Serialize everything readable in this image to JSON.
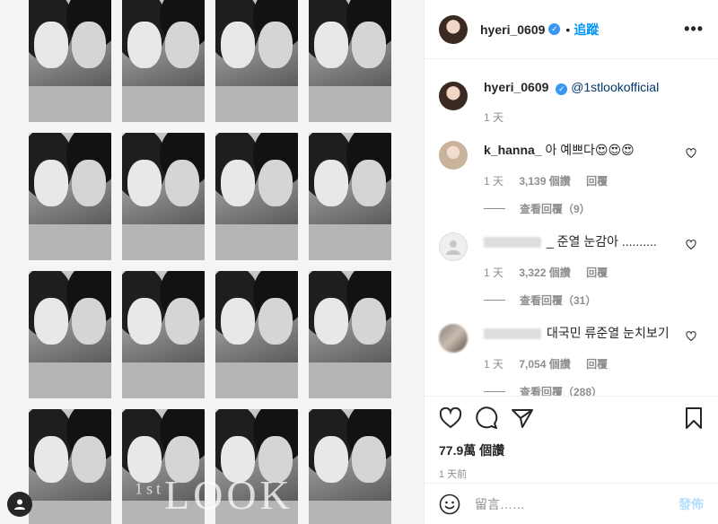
{
  "post_header": {
    "username": "hyeri_0609",
    "separator": "•",
    "follow_label": "追蹤",
    "more_label": "•••"
  },
  "caption": {
    "username": "hyeri_0609",
    "text": "@1stlookofficial",
    "time": "1 天"
  },
  "comments": [
    {
      "username": "k_hanna_",
      "text": "아 예쁘다😍😍😍",
      "time": "1 天",
      "likes": "3,139 個讚",
      "reply_label": "回覆",
      "view_replies": "查看回覆（9）"
    },
    {
      "username": "",
      "text": "_ 준열 눈감아 ..........",
      "time": "1 天",
      "likes": "3,322 個讚",
      "reply_label": "回覆",
      "view_replies": "查看回覆（31）"
    },
    {
      "username": "",
      "text": "대국민 류준열 눈치보기",
      "time": "1 天",
      "likes": "7,054 個讚",
      "reply_label": "回覆",
      "view_replies": "查看回覆（288）"
    }
  ],
  "actions": {
    "like_count": "77.9萬 個讚",
    "posted_time": "1 天前"
  },
  "add_comment": {
    "placeholder": "留言……",
    "post_label": "發佈"
  },
  "photo": {
    "watermark_sup": "1st",
    "watermark": "LOOK"
  },
  "colors": {
    "accent": "#0095f6",
    "verified": "#3897f0",
    "muted": "#8e8e8e",
    "disabled_post": "#b2dffc"
  }
}
